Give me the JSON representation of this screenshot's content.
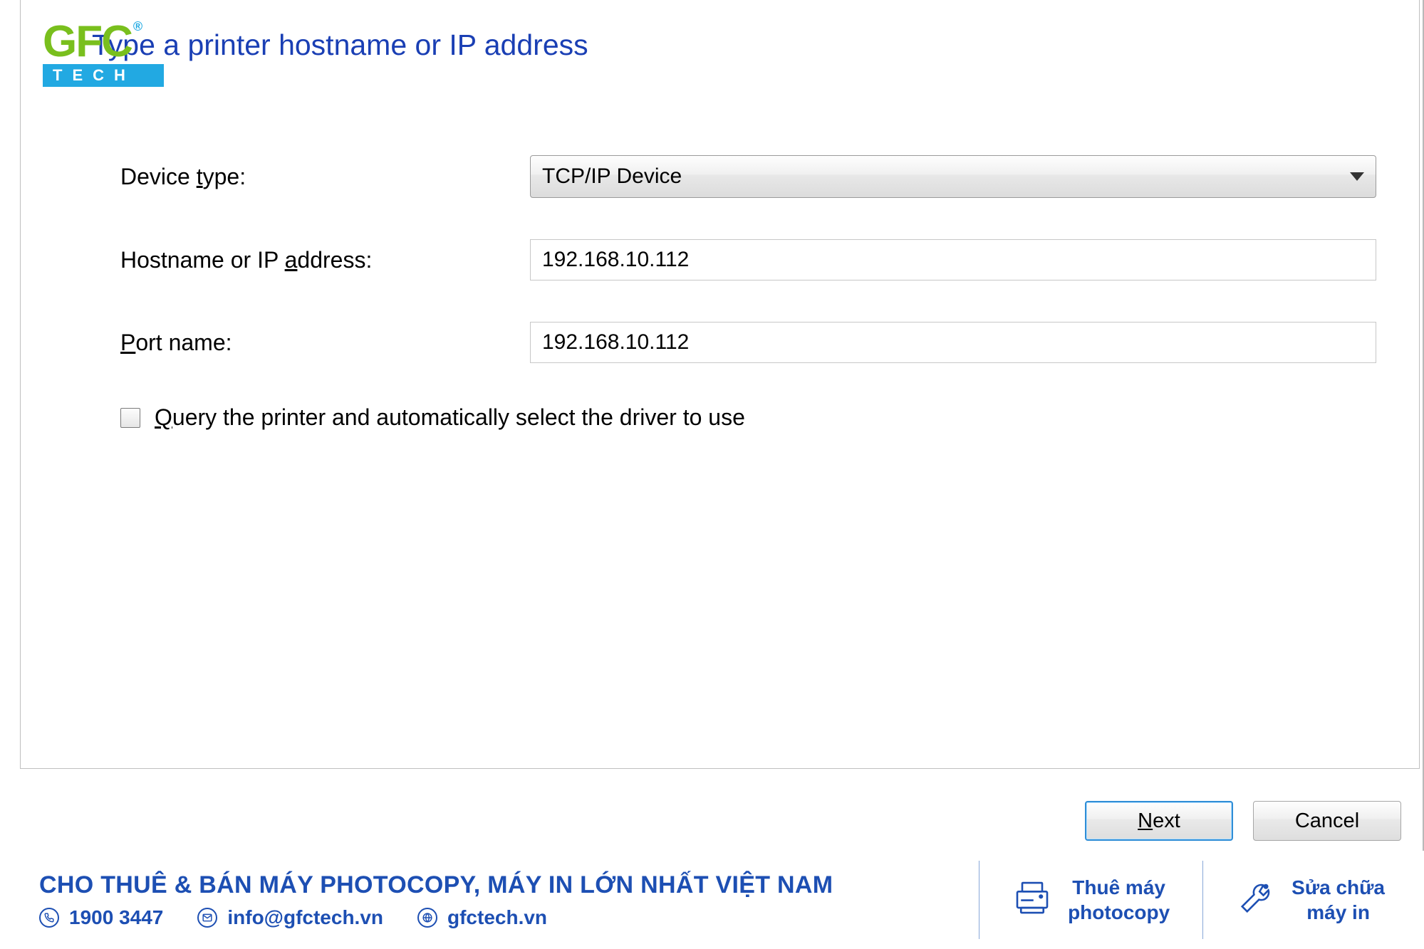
{
  "dialog": {
    "title": "Type a printer hostname or IP address",
    "labels": {
      "device_type_pre": "Device ",
      "device_type_u": "t",
      "device_type_post": "ype:",
      "hostname_pre": "Hostname or IP ",
      "hostname_u": "a",
      "hostname_post": "ddress:",
      "port_u": "P",
      "port_post": "ort name:"
    },
    "fields": {
      "device_type": "TCP/IP Device",
      "hostname": "192.168.10.112",
      "port_name": "192.168.10.112"
    },
    "checkbox": {
      "pre": "",
      "u": "Q",
      "post": "uery the printer and automatically select the driver to use",
      "checked": false
    },
    "buttons": {
      "next_u": "N",
      "next_post": "ext",
      "cancel": "Cancel"
    }
  },
  "logo": {
    "main": "GFC",
    "reg": "®",
    "sub": "TECH"
  },
  "footer": {
    "title": "CHO THUÊ & BÁN MÁY PHOTOCOPY, MÁY IN LỚN NHẤT VIỆT NAM",
    "phone": "1900 3447",
    "email": "info@gfctech.vn",
    "web": "gfctech.vn",
    "service1_line1": "Thuê máy",
    "service1_line2": "photocopy",
    "service2_line1": "Sửa chữa",
    "service2_line2": "máy in"
  }
}
